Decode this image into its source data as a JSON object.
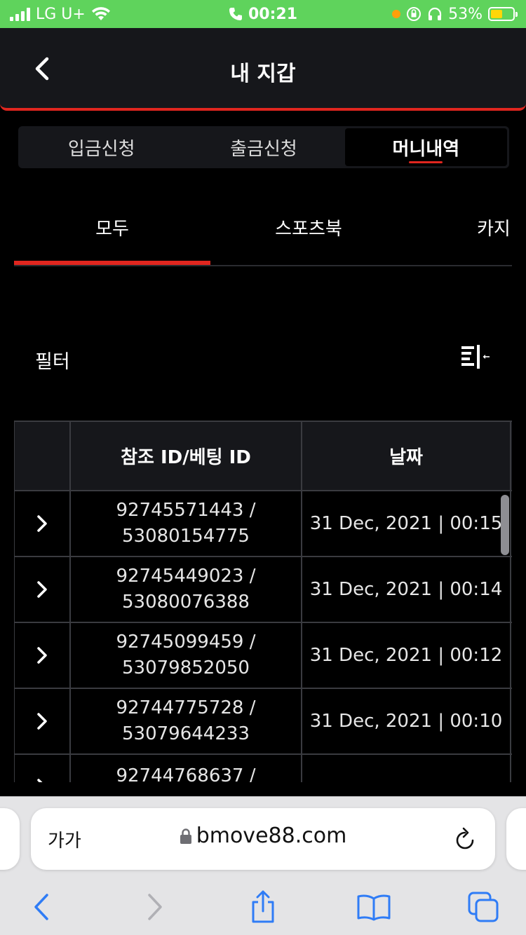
{
  "status_bar": {
    "carrier": "LG U+",
    "time": "00:21",
    "battery": "53%"
  },
  "header": {
    "title": "내 지갑"
  },
  "segments": [
    {
      "label": "입금신청",
      "active": false
    },
    {
      "label": "출금신청",
      "active": false
    },
    {
      "label": "머니내역",
      "active": true
    }
  ],
  "categories": [
    {
      "label": "모두",
      "active": true
    },
    {
      "label": "스포츠북",
      "active": false
    },
    {
      "label": "카지",
      "active": false
    }
  ],
  "filter": {
    "label": "필터"
  },
  "table": {
    "headers": [
      "",
      "참조 ID/베팅 ID",
      "날짜"
    ],
    "rows": [
      {
        "ref_id": "92745571443 /",
        "bet_id": "53080154775",
        "date": "31 Dec, 2021 | 00:15"
      },
      {
        "ref_id": "92745449023 /",
        "bet_id": "53080076388",
        "date": "31 Dec, 2021 | 00:14"
      },
      {
        "ref_id": "92745099459 /",
        "bet_id": "53079852050",
        "date": "31 Dec, 2021 | 00:12"
      },
      {
        "ref_id": "92744775728 /",
        "bet_id": "53079644233",
        "date": "31 Dec, 2021 | 00:10"
      },
      {
        "ref_id": "92744768637 /",
        "bet_id": "",
        "date": ""
      }
    ]
  },
  "browser": {
    "text_size_label": "가가",
    "url": "bmove88.com"
  },
  "colors": {
    "accent": "#e0261f",
    "status_bar": "#5fd35c",
    "header_bg": "#16171b",
    "safari_blue": "#2f7cf6"
  }
}
